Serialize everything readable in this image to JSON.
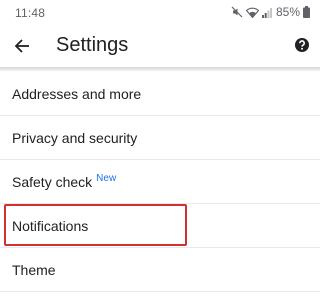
{
  "status_bar": {
    "time": "11:48",
    "battery": "85%"
  },
  "header": {
    "title": "Settings",
    "back_icon": "arrow-back-icon",
    "help_icon": "help-icon"
  },
  "settings": {
    "items": [
      {
        "label": "Addresses and more"
      },
      {
        "label": "Privacy and security"
      },
      {
        "label": "Safety check",
        "badge": "New"
      },
      {
        "label": "Notifications"
      },
      {
        "label": "Theme"
      }
    ]
  },
  "colors": {
    "highlight": "#d32f2f",
    "badge": "#1a73e8"
  }
}
